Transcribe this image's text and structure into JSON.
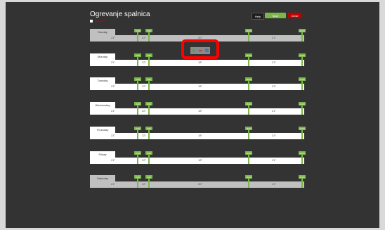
{
  "header": {
    "title": "Ogrevanje spalnica",
    "legend_label": "Comfort"
  },
  "buttons": {
    "help": "Help",
    "save": "Save",
    "close": "Close"
  },
  "toolbox": {
    "icons": [
      "plus-icon",
      "minus-icon",
      "copy-icon"
    ]
  },
  "days": [
    {
      "name": "Sunday",
      "shaded": true,
      "markers": [
        "6:00",
        "8:00",
        "18:00",
        "24:00"
      ],
      "temps": [
        "21°",
        "22°",
        "20°",
        "21°"
      ]
    },
    {
      "name": "Monday",
      "shaded": false,
      "markers": [
        "6:00",
        "8:00",
        "18:00",
        "24:00"
      ],
      "temps": [
        "21°",
        "22°",
        "18°",
        "21°"
      ]
    },
    {
      "name": "Tuesday",
      "shaded": false,
      "markers": [
        "6:00",
        "8:00",
        "18:00",
        "24:00"
      ],
      "temps": [
        "21°",
        "22°",
        "18°",
        "21°"
      ]
    },
    {
      "name": "Wednesday",
      "shaded": false,
      "markers": [
        "6:00",
        "8:00",
        "18:00",
        "24:00"
      ],
      "temps": [
        "21°",
        "22°",
        "18°",
        "21°"
      ]
    },
    {
      "name": "Thursday",
      "shaded": false,
      "markers": [
        "6:00",
        "8:00",
        "18:00",
        "24:00"
      ],
      "temps": [
        "21°",
        "22°",
        "18°",
        "21°"
      ]
    },
    {
      "name": "Friday",
      "shaded": false,
      "markers": [
        "6:00",
        "8:00",
        "18:00",
        "24:00"
      ],
      "temps": [
        "21°",
        "22°",
        "18°",
        "21°"
      ]
    },
    {
      "name": "Saturday",
      "shaded": true,
      "markers": [
        "6:00",
        "8:00",
        "18:00",
        "24:00"
      ],
      "temps": [
        "21°",
        "22°",
        "20°",
        "21°"
      ]
    }
  ]
}
